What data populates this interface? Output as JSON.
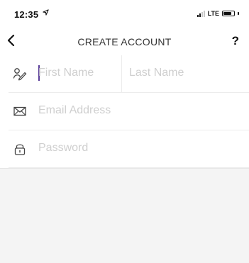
{
  "status_bar": {
    "time": "12:35",
    "network": "LTE",
    "signal_bars_active": 2,
    "signal_bars_total": 4,
    "battery_level": 0.8
  },
  "nav": {
    "back_icon": "chevron-left-icon",
    "title": "CREATE ACCOUNT",
    "help_label": "?"
  },
  "form": {
    "first_name": {
      "value": "",
      "placeholder": "First Name",
      "icon": "signature-icon"
    },
    "last_name": {
      "value": "",
      "placeholder": "Last Name"
    },
    "email": {
      "value": "",
      "placeholder": "Email Address",
      "icon": "envelope-icon"
    },
    "password": {
      "value": "",
      "placeholder": "Password",
      "icon": "lock-icon"
    }
  },
  "colors": {
    "caret": "#5a3d99",
    "placeholder": "#cfcfcf",
    "divider": "#ececec",
    "footer_background": "#f4f4f4"
  }
}
